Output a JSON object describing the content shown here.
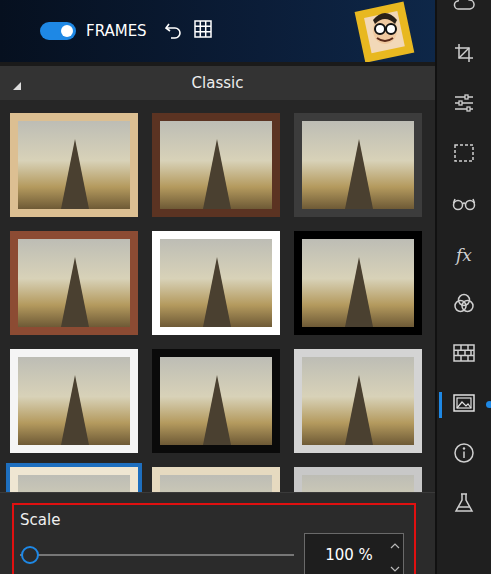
{
  "toolbar": {
    "toggle": {
      "label": "FRAMES",
      "on": true
    }
  },
  "section": {
    "title": "Classic",
    "expanded": true
  },
  "frames": [
    {
      "color": "#dcbf92",
      "selected": false
    },
    {
      "color": "#5b3322",
      "selected": false
    },
    {
      "color": "#3c3c3c",
      "selected": false
    },
    {
      "color": "#8c4b33",
      "selected": false
    },
    {
      "color": "#ffffff",
      "selected": false
    },
    {
      "color": "#000000",
      "selected": false
    },
    {
      "color": "#f5f5f5",
      "selected": false
    },
    {
      "color": "#0a0a0a",
      "selected": false
    },
    {
      "color": "#d4d4d4",
      "selected": false
    },
    {
      "color": "#efe6d2",
      "selected": true
    },
    {
      "color": "#e6dac0",
      "selected": false
    },
    {
      "color": "#c8c8c8",
      "selected": false
    }
  ],
  "scale": {
    "label": "Scale",
    "level": 0,
    "value": "100 %",
    "highlighted": true
  },
  "sidebar": {
    "items": [
      {
        "kind": "cloud",
        "selected": false
      },
      {
        "kind": "crop",
        "selected": false
      },
      {
        "kind": "sliders",
        "selected": false
      },
      {
        "kind": "select",
        "selected": false
      },
      {
        "kind": "glasses",
        "selected": false
      },
      {
        "kind": "fx",
        "label": "fx",
        "selected": false
      },
      {
        "kind": "circles",
        "selected": false
      },
      {
        "kind": "bricks",
        "selected": false
      },
      {
        "kind": "image",
        "selected": true
      },
      {
        "kind": "info",
        "selected": false
      },
      {
        "kind": "flask",
        "selected": false
      }
    ]
  }
}
